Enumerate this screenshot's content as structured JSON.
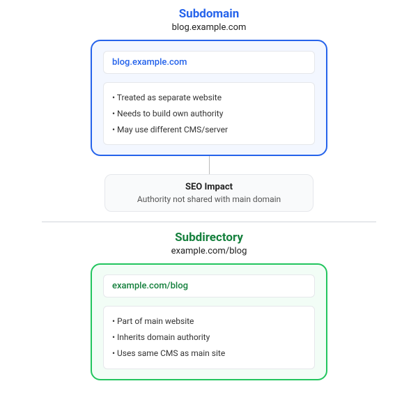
{
  "subdomain": {
    "title": "Subdomain",
    "subtitle": "blog.example.com",
    "url": "blog.example.com",
    "points": [
      "• Treated as separate website",
      "• Needs to build own authority",
      "• May use different CMS/server"
    ],
    "color": "#2563eb"
  },
  "impact": {
    "title": "SEO Impact",
    "text": "Authority not shared with main domain"
  },
  "subdirectory": {
    "title": "Subdirectory",
    "subtitle": "example.com/blog",
    "url": "example.com/blog",
    "points": [
      "• Part of main website",
      "• Inherits domain authority",
      "• Uses same CMS as main site"
    ],
    "color": "#22c55e"
  }
}
